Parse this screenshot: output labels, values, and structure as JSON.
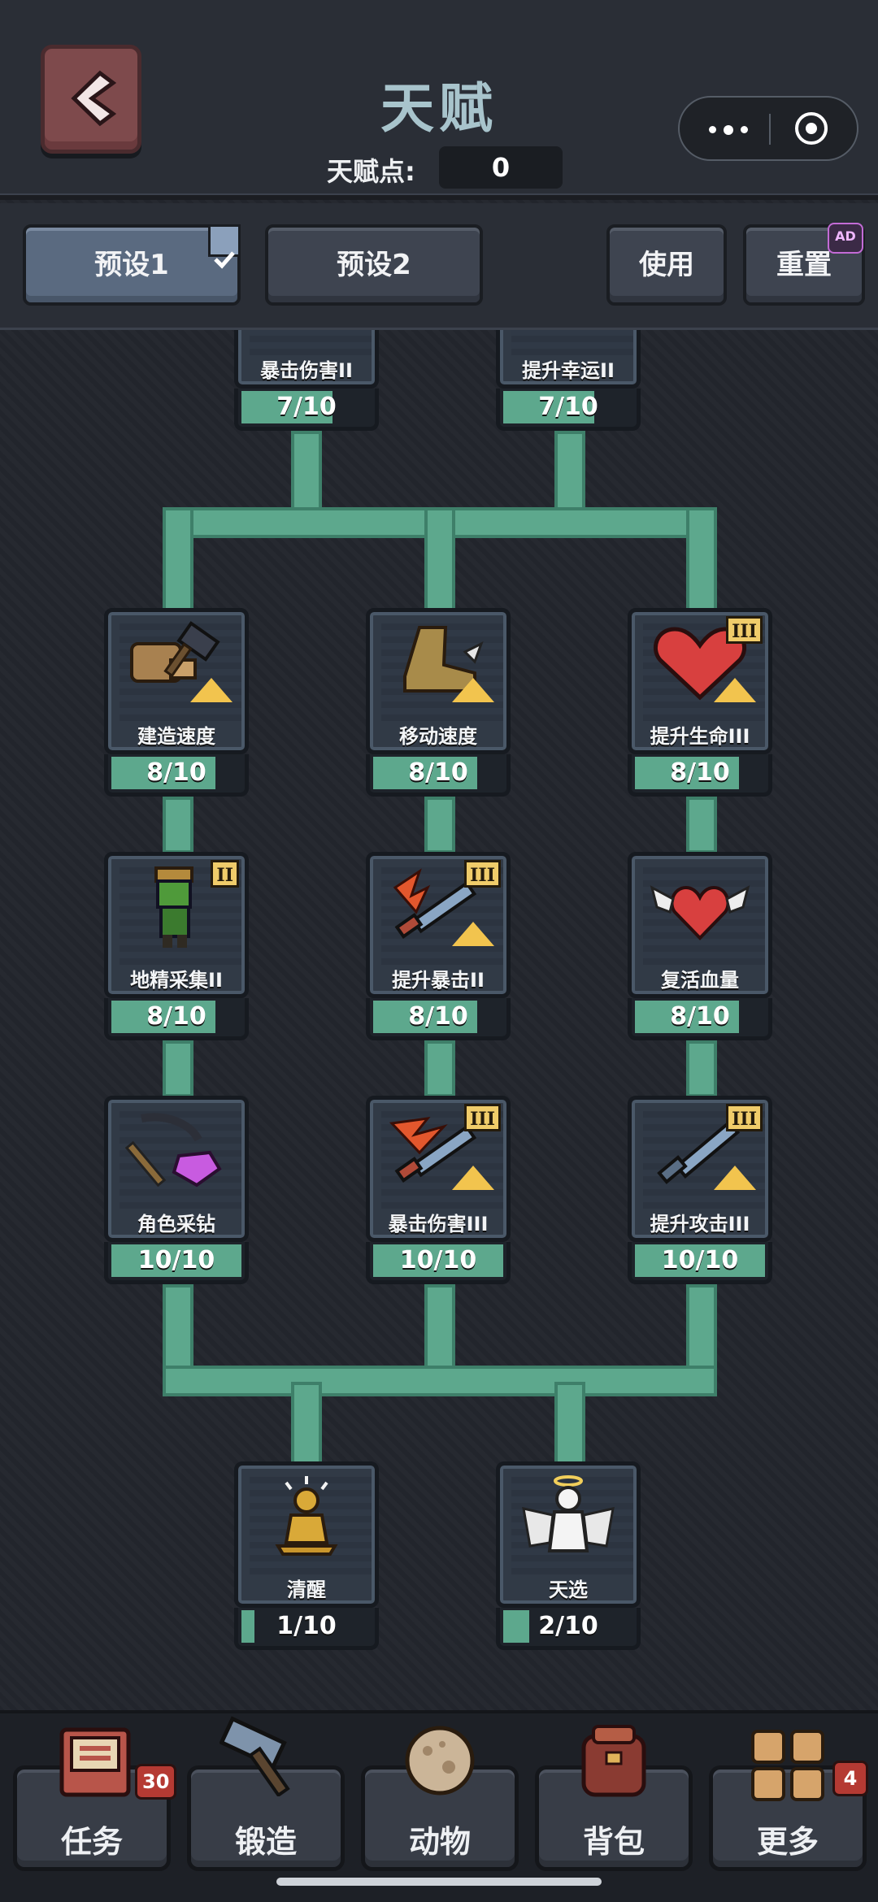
{
  "header": {
    "title": "天赋",
    "points_label": "天赋点:",
    "points_value": "0"
  },
  "presets": {
    "preset1": "预设1",
    "preset2": "预设2",
    "use": "使用",
    "reset": "重置",
    "reset_badge": "AD",
    "selected": "预设1"
  },
  "talents": [
    {
      "id": "crit-dmg-2",
      "label": "暴击伤害II",
      "progress": "7/10",
      "value": 7,
      "max": 10
    },
    {
      "id": "luck-2",
      "label": "提升幸运II",
      "progress": "7/10",
      "value": 7,
      "max": 10
    },
    {
      "id": "build-speed",
      "label": "建造速度",
      "progress": "8/10",
      "value": 8,
      "max": 10
    },
    {
      "id": "move-speed",
      "label": "移动速度",
      "progress": "8/10",
      "value": 8,
      "max": 10
    },
    {
      "id": "hp-3",
      "label": "提升生命III",
      "progress": "8/10",
      "value": 8,
      "max": 10,
      "roman": "III"
    },
    {
      "id": "goblin-gather-2",
      "label": "地精采集II",
      "progress": "8/10",
      "value": 8,
      "max": 10,
      "roman": "II"
    },
    {
      "id": "crit-2",
      "label": "提升暴击II",
      "progress": "8/10",
      "value": 8,
      "max": 10,
      "roman": "III"
    },
    {
      "id": "revive-hp",
      "label": "复活血量",
      "progress": "8/10",
      "value": 8,
      "max": 10
    },
    {
      "id": "role-mining",
      "label": "角色采钻",
      "progress": "10/10",
      "value": 10,
      "max": 10
    },
    {
      "id": "crit-dmg-3",
      "label": "暴击伤害III",
      "progress": "10/10",
      "value": 10,
      "max": 10,
      "roman": "III"
    },
    {
      "id": "attack-3",
      "label": "提升攻击III",
      "progress": "10/10",
      "value": 10,
      "max": 10,
      "roman": "III"
    },
    {
      "id": "awaken",
      "label": "清醒",
      "progress": "1/10",
      "value": 1,
      "max": 10
    },
    {
      "id": "chosen",
      "label": "天选",
      "progress": "2/10",
      "value": 2,
      "max": 10
    }
  ],
  "nav": [
    {
      "label": "任务",
      "icon": "task-book-icon",
      "badge": "30"
    },
    {
      "label": "锻造",
      "icon": "hammer-icon",
      "badge": ""
    },
    {
      "label": "动物",
      "icon": "egg-icon",
      "badge": ""
    },
    {
      "label": "背包",
      "icon": "backpack-icon",
      "badge": ""
    },
    {
      "label": "更多",
      "icon": "grid-icon",
      "badge": "4"
    }
  ],
  "colors": {
    "accent_green": "#5da88d",
    "title": "#a8c4cc",
    "background": "#23262d",
    "badge_red": "#b53a33"
  }
}
